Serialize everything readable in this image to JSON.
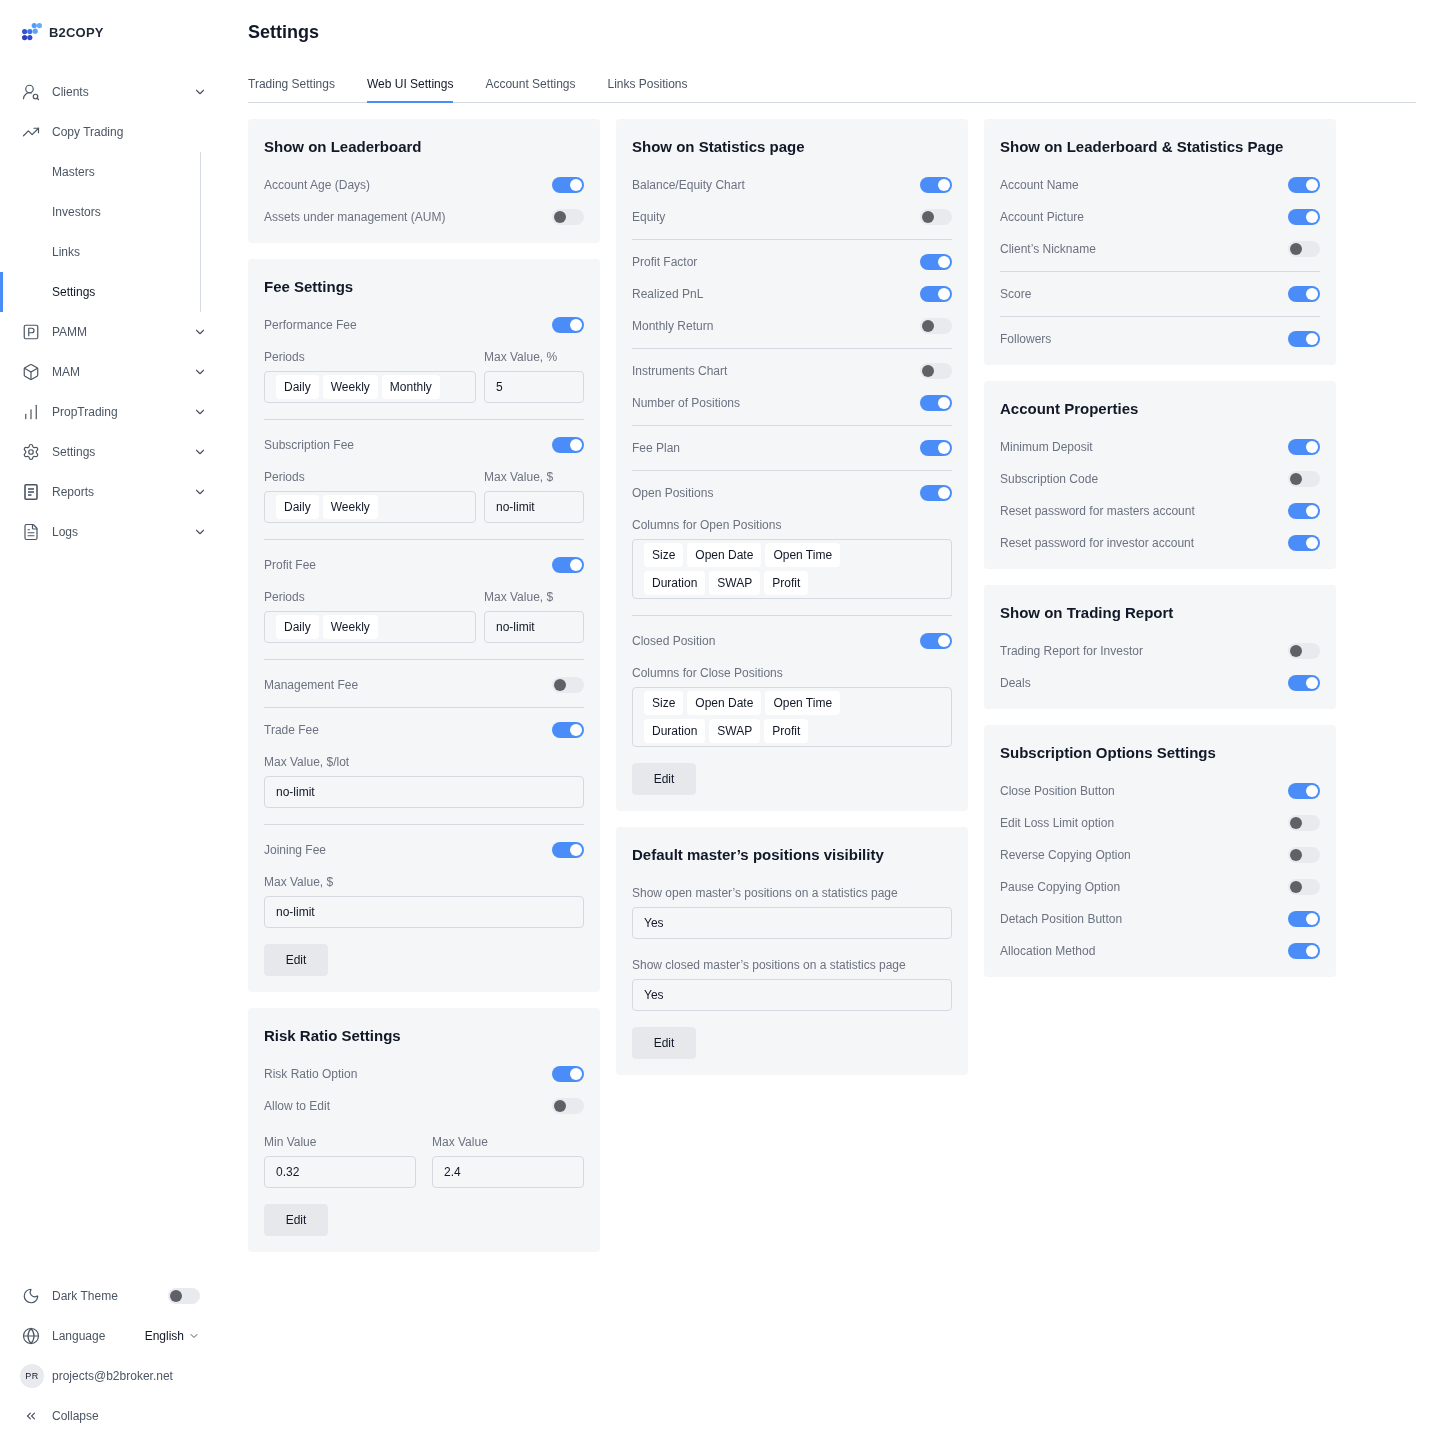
{
  "brand": {
    "name": "B2COPY"
  },
  "sidebar": {
    "items": [
      {
        "label": "Clients",
        "expanded": false
      },
      {
        "label": "Copy Trading",
        "expanded": true,
        "children": [
          {
            "label": "Masters",
            "selected": false
          },
          {
            "label": "Investors",
            "selected": false
          },
          {
            "label": "Links",
            "selected": false
          },
          {
            "label": "Settings",
            "selected": true
          }
        ]
      },
      {
        "label": "PAMM",
        "expanded": false
      },
      {
        "label": "MAM",
        "expanded": false
      },
      {
        "label": "PropTrading",
        "expanded": false
      },
      {
        "label": "Settings",
        "expanded": false
      },
      {
        "label": "Reports",
        "expanded": false
      },
      {
        "label": "Logs",
        "expanded": false
      }
    ]
  },
  "sidebar_footer": {
    "dark_theme": {
      "label": "Dark Theme",
      "on": false
    },
    "language": {
      "label": "Language",
      "value": "English"
    },
    "user": {
      "initials": "PR",
      "email": "projects@b2broker.net"
    },
    "collapse": {
      "label": "Collapse"
    }
  },
  "page": {
    "title": "Settings"
  },
  "tabs": [
    {
      "label": "Trading Settings",
      "selected": false
    },
    {
      "label": "Web UI Settings",
      "selected": true
    },
    {
      "label": "Account Settings",
      "selected": false
    },
    {
      "label": "Links Positions",
      "selected": false
    }
  ],
  "columns": [
    {
      "cards": [
        {
          "title": "Show on Leaderboard",
          "groups": [
            [
              {
                "kind": "toggle",
                "label": "Account Age (Days)",
                "on": true
              },
              {
                "kind": "toggle",
                "label": "Assets under management (AUM)",
                "on": false
              }
            ]
          ]
        },
        {
          "title": "Fee Settings",
          "groups": [
            [
              {
                "kind": "toggle",
                "label": "Performance Fee",
                "on": true
              },
              {
                "kind": "period_limit",
                "periods_label": "Periods",
                "periods": [
                  "Daily",
                  "Weekly",
                  "Monthly"
                ],
                "limit_label": "Max Value, %",
                "limit_value": "5"
              }
            ],
            [
              {
                "kind": "toggle",
                "label": "Subscription Fee",
                "on": true
              },
              {
                "kind": "period_limit",
                "periods_label": "Periods",
                "periods": [
                  "Daily",
                  "Weekly"
                ],
                "limit_label": "Max Value, $",
                "limit_value": "no-limit"
              }
            ],
            [
              {
                "kind": "toggle",
                "label": "Profit Fee",
                "on": true
              },
              {
                "kind": "period_limit",
                "periods_label": "Periods",
                "periods": [
                  "Daily",
                  "Weekly"
                ],
                "limit_label": "Max Value, $",
                "limit_value": "no-limit"
              }
            ],
            [
              {
                "kind": "toggle",
                "label": "Management Fee",
                "on": false
              }
            ],
            [
              {
                "kind": "toggle",
                "label": "Trade Fee",
                "on": true
              },
              {
                "kind": "field",
                "label": "Max Value, $/lot",
                "value": "no-limit"
              }
            ],
            [
              {
                "kind": "toggle",
                "label": "Joining Fee",
                "on": true
              },
              {
                "kind": "field",
                "label": "Max Value, $",
                "value": "no-limit"
              }
            ]
          ],
          "button": "Edit"
        },
        {
          "title": "Risk Ratio Settings",
          "groups": [
            [
              {
                "kind": "toggle",
                "label": "Risk Ratio Option",
                "on": true
              },
              {
                "kind": "toggle",
                "label": "Allow to Edit",
                "on": false
              },
              {
                "kind": "range",
                "min_label": "Min Value",
                "min_value": "0.32",
                "max_label": "Max Value",
                "max_value": "2.4"
              }
            ]
          ],
          "button": "Edit"
        }
      ]
    },
    {
      "cards": [
        {
          "title": "Show on Statistics page",
          "groups": [
            [
              {
                "kind": "toggle",
                "label": "Balance/Equity Chart",
                "on": true
              },
              {
                "kind": "toggle",
                "label": "Equity",
                "on": false
              }
            ],
            [
              {
                "kind": "toggle",
                "label": "Profit Factor",
                "on": true
              },
              {
                "kind": "toggle",
                "label": "Realized PnL",
                "on": true
              },
              {
                "kind": "toggle",
                "label": "Monthly Return",
                "on": false
              }
            ],
            [
              {
                "kind": "toggle",
                "label": "Instruments Chart",
                "on": false
              },
              {
                "kind": "toggle",
                "label": "Number of Positions",
                "on": true
              }
            ],
            [
              {
                "kind": "toggle",
                "label": "Fee Plan",
                "on": true
              }
            ],
            [
              {
                "kind": "toggle",
                "label": "Open Positions",
                "on": true
              },
              {
                "kind": "chips",
                "label": "Columns for Open Positions",
                "chip_rows": [
                  [
                    "Size",
                    "Open Date",
                    "Open Time"
                  ],
                  [
                    "Duration",
                    "SWAP",
                    "Profit"
                  ]
                ]
              }
            ],
            [
              {
                "kind": "toggle",
                "label": "Closed Position",
                "on": true
              },
              {
                "kind": "chips",
                "label": "Columns for Close Positions",
                "chip_rows": [
                  [
                    "Size",
                    "Open Date",
                    "Open Time"
                  ],
                  [
                    "Duration",
                    "SWAP",
                    "Profit"
                  ]
                ]
              }
            ]
          ],
          "button": "Edit"
        },
        {
          "title": "Default master’s positions visibility",
          "groups": [
            [
              {
                "kind": "field",
                "label": "Show open master’s positions on a statistics page",
                "value": "Yes"
              },
              {
                "kind": "field",
                "label": "Show closed master’s positions on a statistics page",
                "value": "Yes"
              }
            ]
          ],
          "button": "Edit"
        }
      ]
    },
    {
      "cards": [
        {
          "title": "Show on Leaderboard & Statistics Page",
          "groups": [
            [
              {
                "kind": "toggle",
                "label": "Account Name",
                "on": true
              },
              {
                "kind": "toggle",
                "label": "Account Picture",
                "on": true
              },
              {
                "kind": "toggle",
                "label": "Client’s Nickname",
                "on": false
              }
            ],
            [
              {
                "kind": "toggle",
                "label": "Score",
                "on": true
              }
            ],
            [
              {
                "kind": "toggle",
                "label": "Followers",
                "on": true
              }
            ]
          ]
        },
        {
          "title": "Account Properties",
          "groups": [
            [
              {
                "kind": "toggle",
                "label": "Minimum Deposit",
                "on": true
              },
              {
                "kind": "toggle",
                "label": "Subscription Code",
                "on": false
              },
              {
                "kind": "toggle",
                "label": "Reset password for masters account",
                "on": true
              },
              {
                "kind": "toggle",
                "label": "Reset password for investor account",
                "on": true
              }
            ]
          ]
        },
        {
          "title": "Show on Trading Report",
          "groups": [
            [
              {
                "kind": "toggle",
                "label": "Trading Report for Investor",
                "on": false
              },
              {
                "kind": "toggle",
                "label": "Deals",
                "on": true
              }
            ]
          ]
        },
        {
          "title": "Subscription Options Settings",
          "groups": [
            [
              {
                "kind": "toggle",
                "label": "Close Position Button",
                "on": true
              },
              {
                "kind": "toggle",
                "label": "Edit Loss Limit option",
                "on": false
              },
              {
                "kind": "toggle",
                "label": "Reverse Copying Option",
                "on": false
              },
              {
                "kind": "toggle",
                "label": "Pause Copying Option",
                "on": false
              },
              {
                "kind": "toggle",
                "label": "Detach Position Button",
                "on": true
              },
              {
                "kind": "toggle",
                "label": "Allocation Method",
                "on": true
              }
            ]
          ]
        }
      ]
    }
  ]
}
